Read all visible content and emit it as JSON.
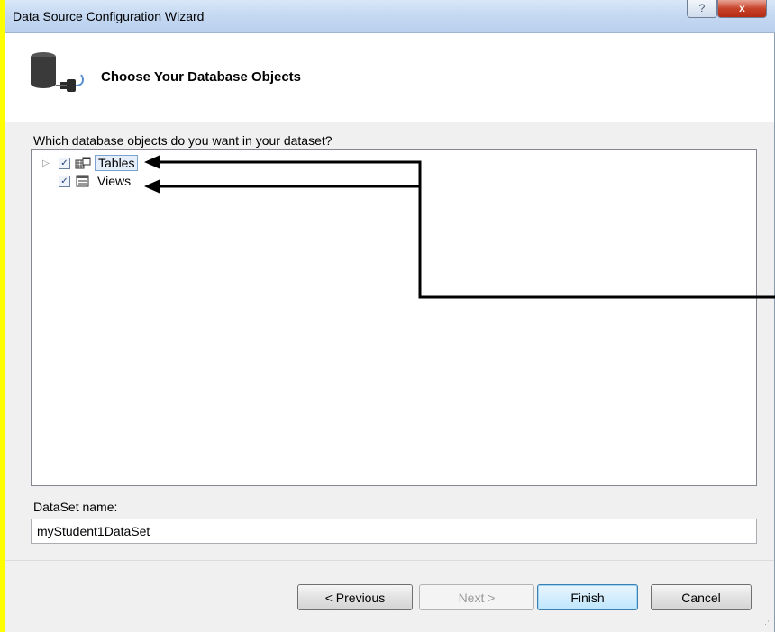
{
  "window": {
    "title": "Data Source Configuration Wizard",
    "help_glyph": "?",
    "close_glyph": "x"
  },
  "header": {
    "title": "Choose Your Database Objects",
    "icon": "database-connect-icon"
  },
  "objects": {
    "prompt": "Which database objects do you want in your dataset?",
    "nodes": [
      {
        "label": "Tables",
        "checked": true,
        "expandable": true,
        "selected": true,
        "icon": "tables-icon"
      },
      {
        "label": "Views",
        "checked": true,
        "expandable": false,
        "selected": false,
        "icon": "views-icon"
      }
    ]
  },
  "dataset": {
    "label": "DataSet name:",
    "value": "myStudent1DataSet"
  },
  "buttons": {
    "previous": "< Previous",
    "next": "Next >",
    "finish": "Finish",
    "cancel": "Cancel"
  },
  "colors": {
    "background": "#ffff00",
    "header": "#ffffff",
    "body": "#f0f0f0",
    "arrow": "#000000"
  }
}
